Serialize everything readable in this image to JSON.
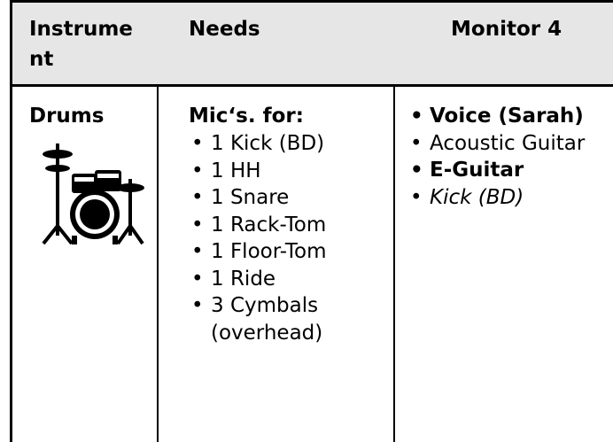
{
  "header": {
    "instrument": "Instrume nt",
    "needs": "Needs",
    "monitor": "Monitor 4"
  },
  "row": {
    "instrument": "Drums",
    "instrument_icon": "drum-kit-icon",
    "needs_title": "Mic‘s. for:",
    "needs_items": [
      "1 Kick (BD)",
      "1 HH",
      "1 Snare",
      "1 Rack-Tom",
      "1 Floor-Tom",
      "1 Ride",
      "3 Cymbals (overhead)"
    ],
    "monitor_items": [
      {
        "text": "Voice (Sarah)",
        "style": "bold"
      },
      {
        "text": "Acoustic Guitar",
        "style": "normal"
      },
      {
        "text": "E-Guitar",
        "style": "bold"
      },
      {
        "text": "Kick (BD)",
        "style": "italic"
      }
    ]
  },
  "colors": {
    "header_background": "#e6e6e6",
    "grid_lines": "#000000",
    "text": "#000000"
  }
}
